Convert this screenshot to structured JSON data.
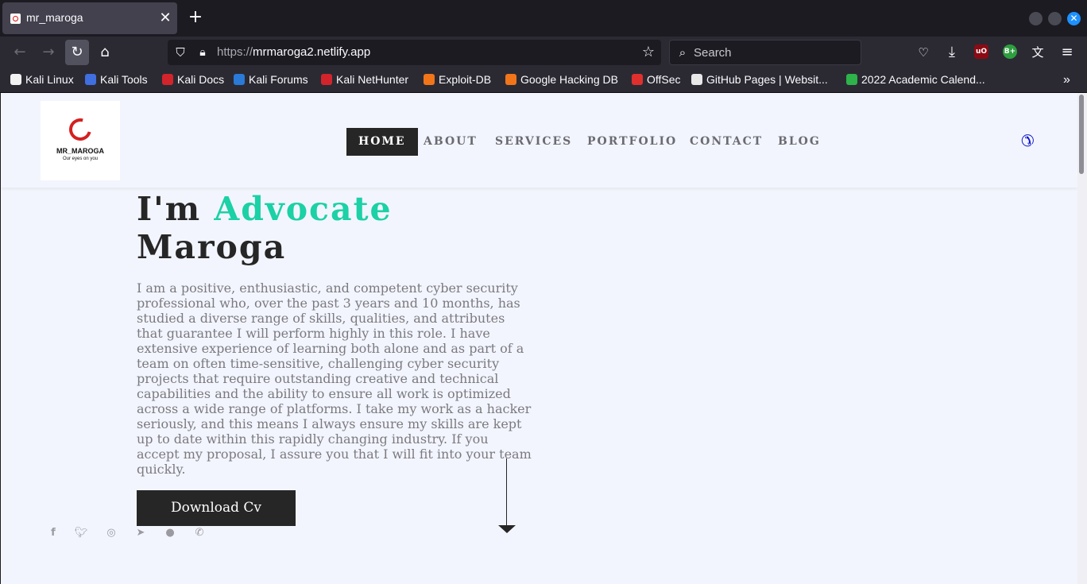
{
  "browser": {
    "tab_title": "mr_maroga",
    "new_tab_label": "+",
    "url_protocol": "https://",
    "url_host": "mrmaroga2.netlify.app",
    "search_placeholder": "Search",
    "bookmarks": [
      {
        "label": "Kali Linux",
        "color": "#f2f2f2"
      },
      {
        "label": "Kali Tools",
        "color": "#3f6fe0"
      },
      {
        "label": "Kali Docs",
        "color": "#d3242c"
      },
      {
        "label": "Kali Forums",
        "color": "#2a7ad8"
      },
      {
        "label": "Kali NetHunter",
        "color": "#d3242c"
      },
      {
        "label": "Exploit-DB",
        "color": "#f2751a"
      },
      {
        "label": "Google Hacking DB",
        "color": "#f2751a"
      },
      {
        "label": "OffSec",
        "color": "#e0302e"
      },
      {
        "label": "GitHub Pages | Websit...",
        "color": "#e8e8e8"
      },
      {
        "label": "2022 Academic Calend...",
        "color": "#2eb24a"
      }
    ]
  },
  "site": {
    "logo_brand": "MR_MAROGA",
    "logo_tagline": "Our eyes on you",
    "menu": [
      "HOME",
      "ABOUT",
      "SERVICES",
      "PORTFOLIO",
      "CONTACT",
      "BLOG"
    ],
    "hero_prefix": "I'm ",
    "hero_accent": "Advocate",
    "hero_name": "Maroga",
    "hero_description": "I am a positive, enthusiastic, and competent cyber security professional who, over the past 3 years and 10 months, has studied a diverse range of skills, qualities, and attributes that guarantee I will perform highly in this role. I have extensive experience of learning both alone and as part of a team on often time-sensitive, challenging cyber security projects that require outstanding creative and technical capabilities and the ability to ensure all work is optimized across a wide range of platforms. I take my work as a hacker seriously, and this means I always ensure my skills are kept up to date within this rapidly changing industry. If you accept my proposal, I assure you that I will fit into your team quickly.",
    "cv_button": "Download Cv",
    "accent_color": "#1bd1a5",
    "social_icons": [
      "facebook-icon",
      "twitter-icon",
      "instagram-icon",
      "telegram-icon",
      "github-icon",
      "whatsapp-icon"
    ]
  }
}
